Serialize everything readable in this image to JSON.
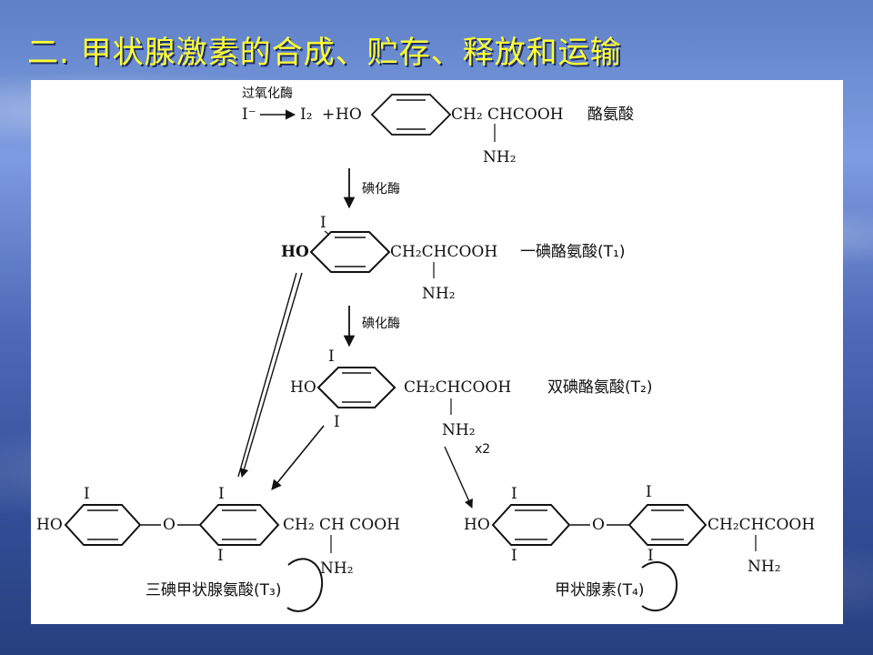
{
  "slide": {
    "title": "二. 甲状腺激素的合成、贮存、释放和运输"
  },
  "diagram": {
    "step0": {
      "enzyme": "过氧化酶",
      "reagent": "I⁻",
      "product": "I₂",
      "plus": "+",
      "ho": "HO",
      "side_chain": "CH₂ CHCOOH",
      "amine": "NH₂",
      "name": "酪氨酸"
    },
    "step1": {
      "enzyme": "碘化酶",
      "iodine": "I",
      "ho": "HO",
      "side_chain": "CH₂CHCOOH",
      "amine": "NH₂",
      "name": "一碘酪氨酸(T₁)"
    },
    "step2": {
      "enzyme": "碘化酶",
      "iodine_top": "I",
      "iodine_bottom": "I",
      "ho": "HO",
      "side_chain": "CH₂CHCOOH",
      "amine": "NH₂",
      "multiplier": "x2",
      "name": "双碘酪氨酸(T₂)"
    },
    "t3": {
      "iodine_a": "I",
      "iodine_b": "I",
      "iodine_c": "I",
      "ho": "HO",
      "ether": "O",
      "side_chain": "CH₂ CH COOH",
      "amine": "NH₂",
      "name": "三碘甲状腺氨酸(T₃)"
    },
    "t4": {
      "iodine_a": "I",
      "iodine_b": "I",
      "iodine_c": "I",
      "iodine_d": "I",
      "ho": "HO",
      "ether": "O",
      "side_chain": "CH₂CHCOOH",
      "amine": "NH₂",
      "name": "甲状腺素(T₄)"
    }
  }
}
